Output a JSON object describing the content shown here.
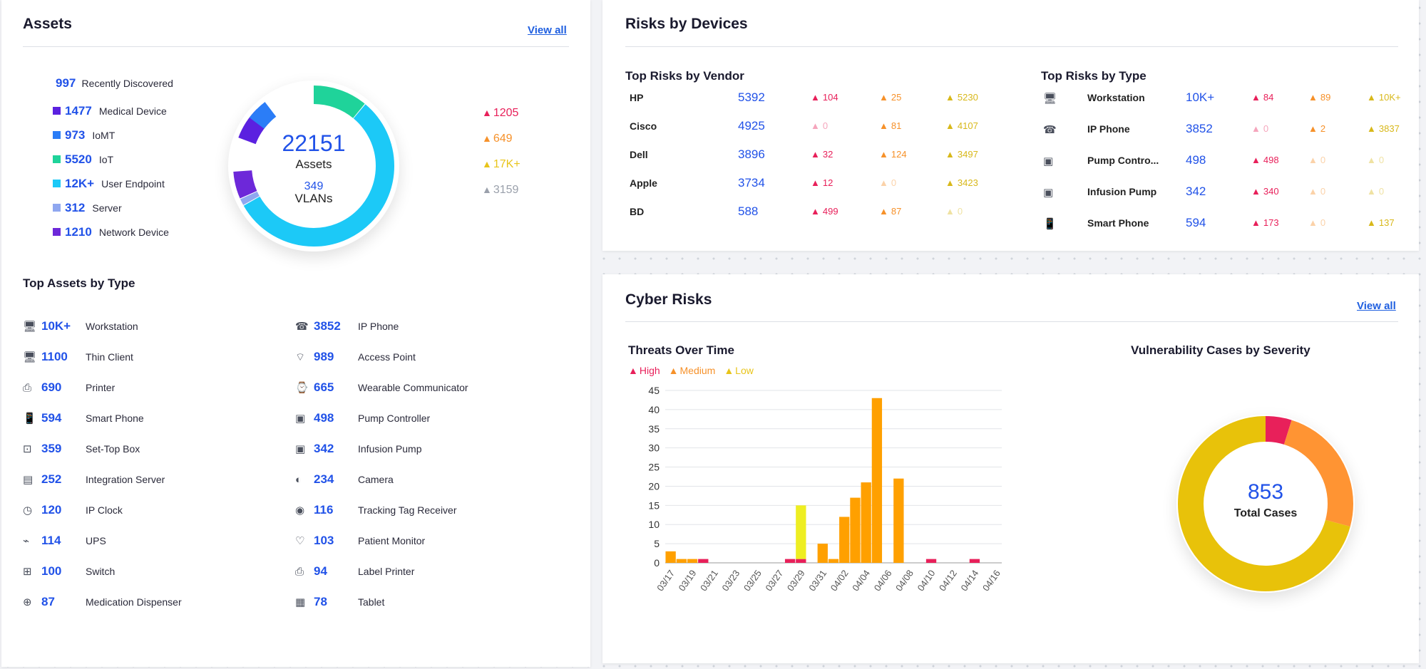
{
  "assets": {
    "title": "Assets",
    "view_all": "View all",
    "recently_discovered": {
      "value": "997",
      "label": "Recently Discovered"
    },
    "categories": [
      {
        "value": "1477",
        "label": "Medical Device",
        "color": "#5b21e0"
      },
      {
        "value": "973",
        "label": "IoMT",
        "color": "#2b7df7"
      },
      {
        "value": "5520",
        "label": "IoT",
        "color": "#1fd39a"
      },
      {
        "value": "12K+",
        "label": "User Endpoint",
        "color": "#1cc9f7"
      },
      {
        "value": "312",
        "label": "Server",
        "color": "#8fa7f0"
      },
      {
        "value": "1210",
        "label": "Network Device",
        "color": "#6d28d9"
      }
    ],
    "donut": {
      "total": "22151",
      "total_label": "Assets",
      "vlans": "349",
      "vlans_label": "VLANs"
    },
    "risk_counts": [
      {
        "value": "1205",
        "color": "#e8205a"
      },
      {
        "value": "649",
        "color": "#f6912a"
      },
      {
        "value": "17K+",
        "color": "#e8c41a"
      },
      {
        "value": "3159",
        "color": "#9aa0ab"
      }
    ],
    "top_by_type_title": "Top Assets by Type",
    "top_by_type_left": [
      {
        "value": "10K+",
        "label": "Workstation",
        "icon": "workstation-icon"
      },
      {
        "value": "1100",
        "label": "Thin Client",
        "icon": "thin-client-icon"
      },
      {
        "value": "690",
        "label": "Printer",
        "icon": "printer-icon"
      },
      {
        "value": "594",
        "label": "Smart Phone",
        "icon": "smartphone-icon"
      },
      {
        "value": "359",
        "label": "Set-Top Box",
        "icon": "set-top-box-icon"
      },
      {
        "value": "252",
        "label": "Integration Server",
        "icon": "server-icon"
      },
      {
        "value": "120",
        "label": "IP Clock",
        "icon": "clock-icon"
      },
      {
        "value": "114",
        "label": "UPS",
        "icon": "ups-icon"
      },
      {
        "value": "100",
        "label": "Switch",
        "icon": "switch-icon"
      },
      {
        "value": "87",
        "label": "Medication Dispenser",
        "icon": "dispenser-icon"
      }
    ],
    "top_by_type_right": [
      {
        "value": "3852",
        "label": "IP Phone",
        "icon": "ip-phone-icon"
      },
      {
        "value": "989",
        "label": "Access Point",
        "icon": "access-point-icon"
      },
      {
        "value": "665",
        "label": "Wearable Communicator",
        "icon": "wearable-icon"
      },
      {
        "value": "498",
        "label": "Pump Controller",
        "icon": "pump-icon"
      },
      {
        "value": "342",
        "label": "Infusion Pump",
        "icon": "infusion-pump-icon"
      },
      {
        "value": "234",
        "label": "Camera",
        "icon": "camera-icon"
      },
      {
        "value": "116",
        "label": "Tracking Tag Receiver",
        "icon": "tag-receiver-icon"
      },
      {
        "value": "103",
        "label": "Patient Monitor",
        "icon": "monitor-icon"
      },
      {
        "value": "94",
        "label": "Label Printer",
        "icon": "label-printer-icon"
      },
      {
        "value": "78",
        "label": "Tablet",
        "icon": "tablet-icon"
      }
    ]
  },
  "risks_by_devices": {
    "title": "Risks by Devices",
    "vendor_title": "Top Risks by Vendor",
    "vendors": [
      {
        "name": "HP",
        "total": "5392",
        "high": "104",
        "medium": "25",
        "low": "5230"
      },
      {
        "name": "Cisco",
        "total": "4925",
        "high": "0",
        "medium": "81",
        "low": "4107"
      },
      {
        "name": "Dell",
        "total": "3896",
        "high": "32",
        "medium": "124",
        "low": "3497"
      },
      {
        "name": "Apple",
        "total": "3734",
        "high": "12",
        "medium": "0",
        "low": "3423"
      },
      {
        "name": "BD",
        "total": "588",
        "high": "499",
        "medium": "87",
        "low": "0"
      }
    ],
    "type_title": "Top Risks by Type",
    "types": [
      {
        "name": "Workstation",
        "icon": "workstation-icon",
        "total": "10K+",
        "high": "84",
        "medium": "89",
        "low": "10K+"
      },
      {
        "name": "IP Phone",
        "icon": "ip-phone-icon",
        "total": "3852",
        "high": "0",
        "medium": "2",
        "low": "3837"
      },
      {
        "name": "Pump Contro...",
        "icon": "pump-icon",
        "total": "498",
        "high": "498",
        "medium": "0",
        "low": "0"
      },
      {
        "name": "Infusion Pump",
        "icon": "infusion-pump-icon",
        "total": "342",
        "high": "340",
        "medium": "0",
        "low": "0"
      },
      {
        "name": "Smart Phone",
        "icon": "smartphone-icon",
        "total": "594",
        "high": "173",
        "medium": "0",
        "low": "137"
      }
    ],
    "colors": {
      "high": "#e8205a",
      "medium": "#f6912a",
      "low": "#d8b81a"
    }
  },
  "cyber_risks": {
    "title": "Cyber Risks",
    "view_all": "View all",
    "threats_title": "Threats Over Time",
    "legend": [
      {
        "label": "High",
        "color": "#e8205a"
      },
      {
        "label": "Medium",
        "color": "#f6912a"
      },
      {
        "label": "Low",
        "color": "#e8c41a"
      }
    ],
    "vuln_title": "Vulnerability Cases by Severity",
    "vuln_total": "853",
    "vuln_total_label": "Total Cases"
  },
  "chart_data": [
    {
      "type": "bar",
      "title": "Threats Over Time",
      "stacked": true,
      "x_tick_labels": [
        "03/17",
        "03/19",
        "03/21",
        "03/23",
        "03/25",
        "03/27",
        "03/29",
        "03/31",
        "04/02",
        "04/04",
        "04/06",
        "04/08",
        "04/10",
        "04/12",
        "04/14",
        "04/16"
      ],
      "categories": [
        "03/17",
        "03/18",
        "03/19",
        "03/20",
        "03/21",
        "03/22",
        "03/23",
        "03/24",
        "03/25",
        "03/26",
        "03/27",
        "03/28",
        "03/29",
        "03/30",
        "03/31",
        "04/01",
        "04/02",
        "04/03",
        "04/04",
        "04/05",
        "04/06",
        "04/07",
        "04/08",
        "04/09",
        "04/10",
        "04/11",
        "04/12",
        "04/13",
        "04/14",
        "04/15",
        "04/16"
      ],
      "series": [
        {
          "name": "High",
          "color": "#e8205a",
          "values": [
            0,
            0,
            0,
            1,
            0,
            0,
            0,
            0,
            0,
            0,
            0,
            1,
            1,
            0,
            0,
            0,
            0,
            0,
            0,
            0,
            0,
            0,
            0,
            0,
            1,
            0,
            0,
            0,
            1,
            0,
            0
          ]
        },
        {
          "name": "Medium",
          "color": "#ffa000",
          "values": [
            3,
            1,
            1,
            0,
            0,
            0,
            0,
            0,
            0,
            0,
            0,
            0,
            0,
            0,
            5,
            1,
            12,
            17,
            21,
            43,
            0,
            22,
            0,
            0,
            0,
            0,
            0,
            0,
            0,
            0,
            0
          ]
        },
        {
          "name": "Low",
          "color": "#eeee22",
          "values": [
            0,
            0,
            0,
            0,
            0,
            0,
            0,
            0,
            0,
            0,
            0,
            0,
            14,
            0,
            0,
            0,
            0,
            0,
            0,
            0,
            0,
            0,
            0,
            0,
            0,
            0,
            0,
            0,
            0,
            0,
            0
          ]
        }
      ],
      "ylim": [
        0,
        45
      ],
      "yticks": [
        0,
        5,
        10,
        15,
        20,
        25,
        30,
        35,
        40,
        45
      ],
      "grid": true
    },
    {
      "type": "pie",
      "title": "Vulnerability Cases by Severity",
      "labels": [
        "High",
        "Medium",
        "Low"
      ],
      "values": [
        41,
        208,
        604
      ],
      "colors": [
        "#e8205a",
        "#ff9433",
        "#e8c20a"
      ]
    }
  ]
}
